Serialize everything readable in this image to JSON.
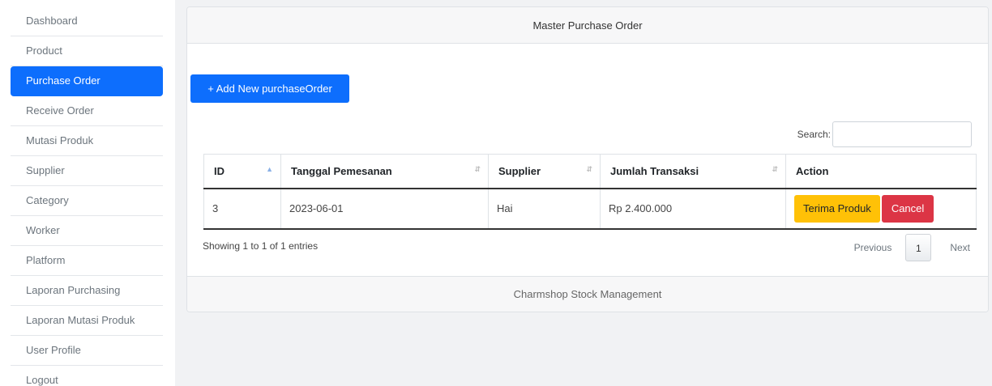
{
  "sidebar": {
    "items": [
      {
        "label": "Dashboard"
      },
      {
        "label": "Product"
      },
      {
        "label": "Purchase Order"
      },
      {
        "label": "Receive Order"
      },
      {
        "label": "Mutasi Produk"
      },
      {
        "label": "Supplier"
      },
      {
        "label": "Category"
      },
      {
        "label": "Worker"
      },
      {
        "label": "Platform"
      },
      {
        "label": "Laporan Purchasing"
      },
      {
        "label": "Laporan Mutasi Produk"
      },
      {
        "label": "User Profile"
      },
      {
        "label": "Logout"
      }
    ],
    "active_index": 2
  },
  "card": {
    "title": "Master Purchase Order",
    "footer": "Charmshop Stock Management",
    "add_button": "+ Add New purchaseOrder"
  },
  "search": {
    "label": "Search:",
    "value": ""
  },
  "table": {
    "headers": [
      "ID",
      "Tanggal Pemesanan",
      "Supplier",
      "Jumlah Transaksi",
      "Action"
    ],
    "rows": [
      {
        "id": "3",
        "tanggal": "2023-06-01",
        "supplier": "Hai",
        "jumlah": "Rp 2.400.000",
        "actions": {
          "accept": "Terima Produk",
          "cancel": "Cancel"
        }
      }
    ]
  },
  "pagination": {
    "info": "Showing 1 to 1 of 1 entries",
    "previous": "Previous",
    "current_page": "1",
    "next": "Next"
  },
  "colors": {
    "primary": "#0d6efd",
    "warning": "#ffc107",
    "danger": "#dc3545"
  }
}
